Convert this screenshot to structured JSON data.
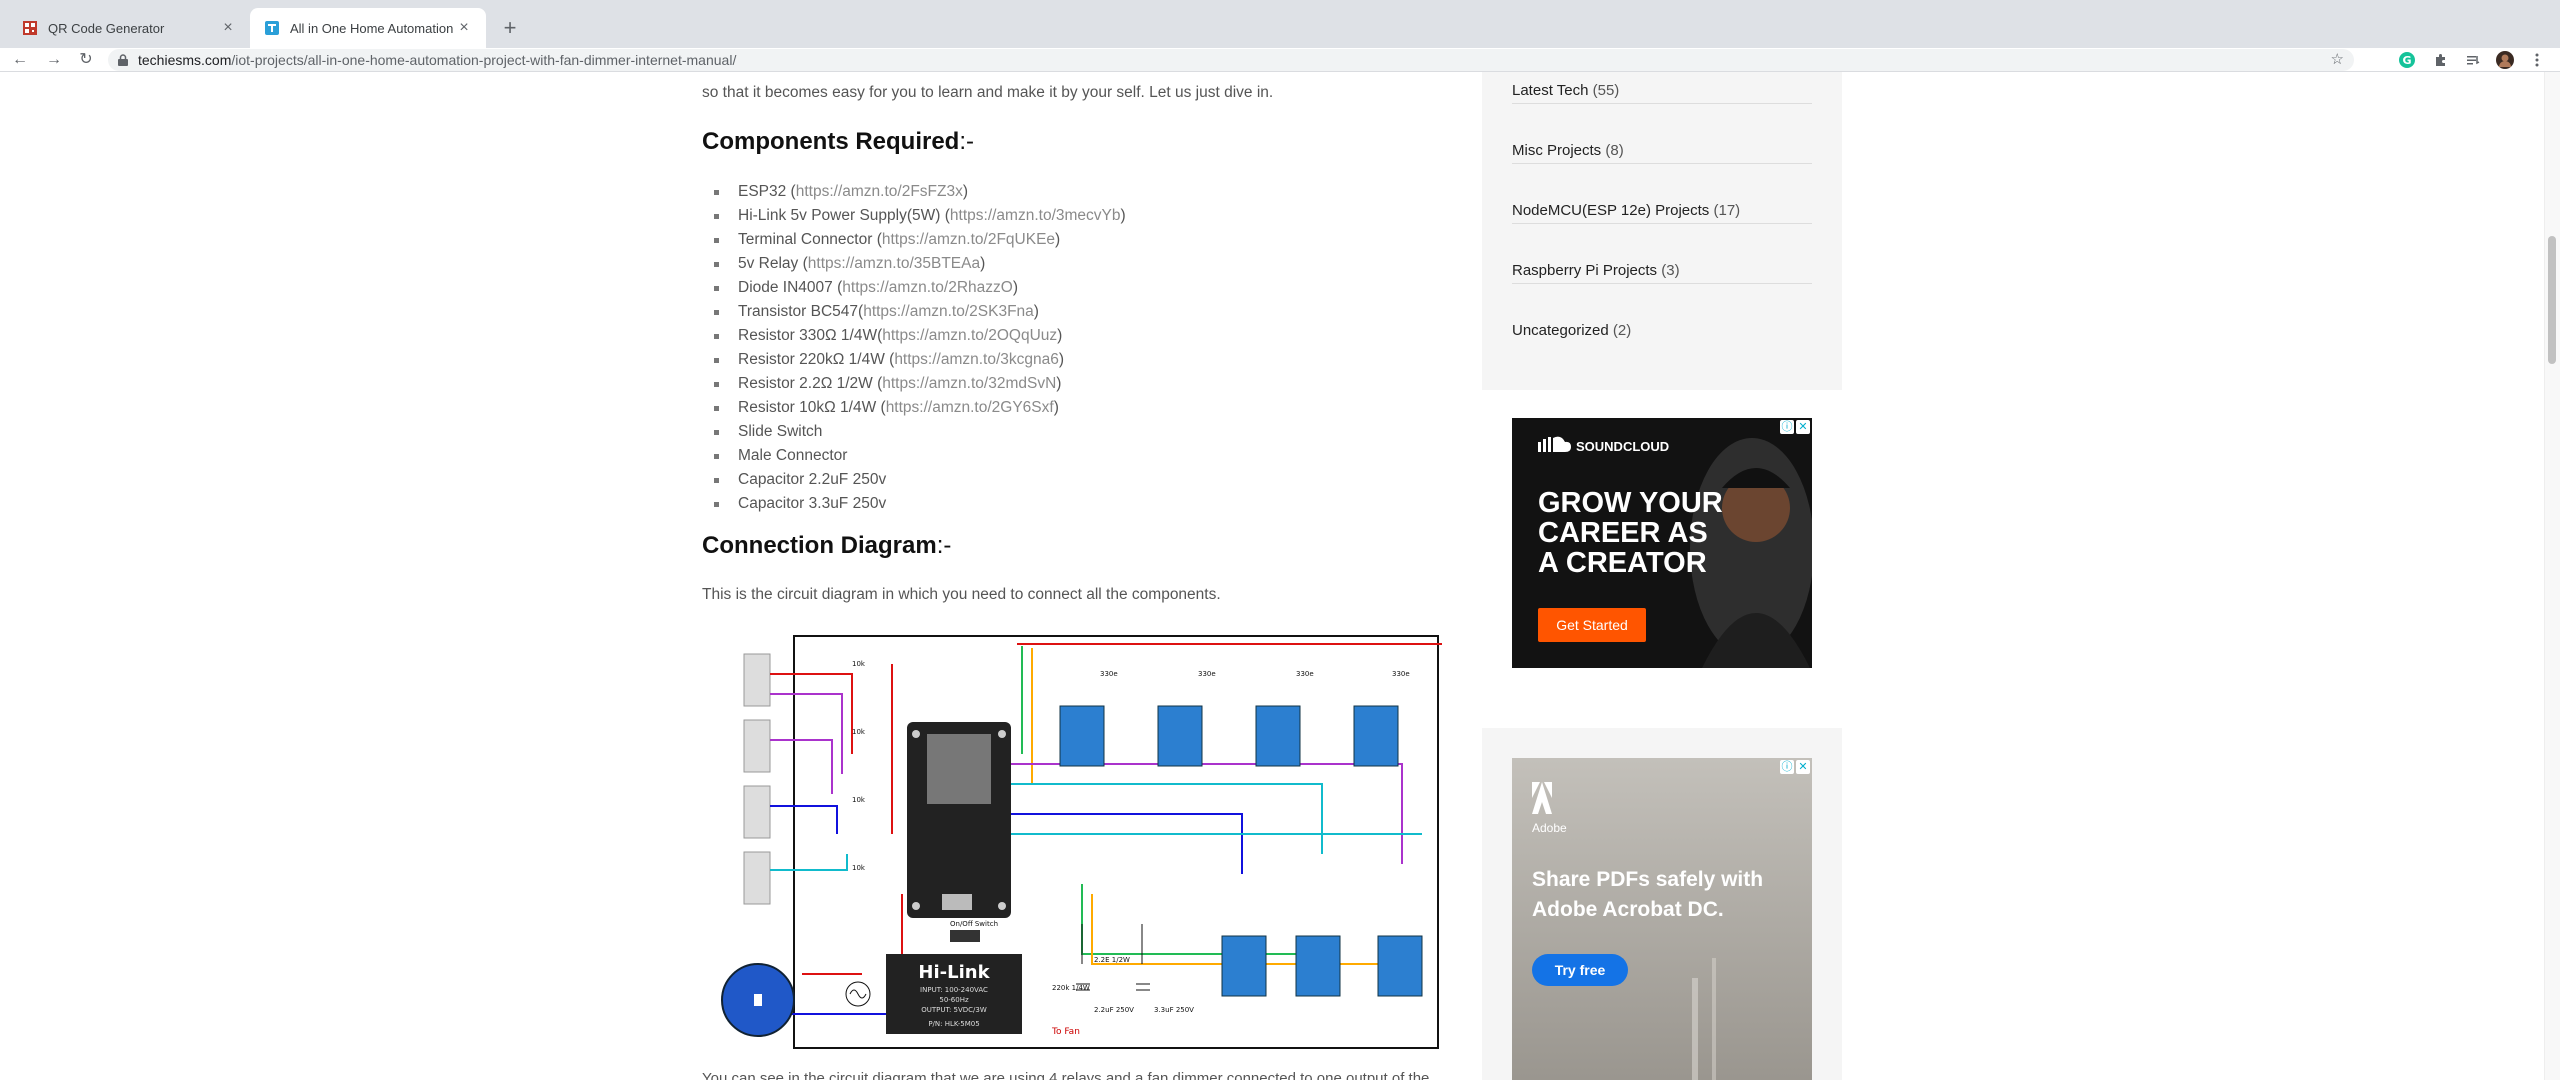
{
  "browser": {
    "tabs": [
      {
        "title": "QR Code Generator",
        "active": false
      },
      {
        "title": "All in One Home Automation p",
        "active": true
      }
    ],
    "url_host": "techiesms.com",
    "url_path": "/iot-projects/all-in-one-home-automation-project-with-fan-dimmer-internet-manual/"
  },
  "article": {
    "intro_tail": "so that it becomes easy for you to learn and make it by your self. Let us just dive in.",
    "components_heading": "Components Required",
    "heading_suffix": ":-",
    "components": [
      {
        "name": "ESP32 (",
        "link": "https://amzn.to/2FsFZ3x",
        "close": ")"
      },
      {
        "name": "Hi-Link 5v Power Supply(5W) (",
        "link": "https://amzn.to/3mecvYb",
        "close": ")"
      },
      {
        "name": "Terminal Connector (",
        "link": "https://amzn.to/2FqUKEe",
        "close": ")"
      },
      {
        "name": "5v Relay (",
        "link": "https://amzn.to/35BTEAa",
        "close": ")"
      },
      {
        "name": "Diode IN4007 (",
        "link": "https://amzn.to/2RhazzO",
        "close": ")"
      },
      {
        "name": "Transistor BC547(",
        "link": "https://amzn.to/2SK3Fna",
        "close": ")"
      },
      {
        "name": "Resistor 330Ω 1/4W(",
        "link": "https://amzn.to/2OQqUuz",
        "close": ")"
      },
      {
        "name": "Resistor 220kΩ 1/4W (",
        "link": "https://amzn.to/3kcgna6",
        "close": ")"
      },
      {
        "name": "Resistor 2.2Ω 1/2W (",
        "link": "https://amzn.to/32mdSvN",
        "close": ")"
      },
      {
        "name": "Resistor 10kΩ 1/4W (",
        "link": "https://amzn.to/2GY6Sxf",
        "close": ")"
      },
      {
        "name": "Slide Switch",
        "link": "",
        "close": ""
      },
      {
        "name": "Male Connector",
        "link": "",
        "close": ""
      },
      {
        "name": "Capacitor 2.2uF 250v",
        "link": "",
        "close": ""
      },
      {
        "name": "Capacitor 3.3uF 250v",
        "link": "",
        "close": ""
      }
    ],
    "connection_heading": "Connection Diagram",
    "connection_desc": "This is the circuit diagram in which you need to connect all the components.",
    "diagram_labels": {
      "hilink_brand": "Hi-Link",
      "hilink_input": "INPUT: 100-240VAC",
      "hilink_freq": "50-60Hz",
      "hilink_output": "OUTPUT: 5VDC/3W",
      "hilink_model": "P/N: HLK-5M05",
      "switch": "On/Off Switch",
      "to_fan": "To Fan",
      "res_330": "330e",
      "res_10k": "10k",
      "res_22": "2.2E 1/2W",
      "cap_22": "2.2uF 250V",
      "cap_33": "3.3uF 250V",
      "res_220k": "220k 1/4W"
    },
    "bottom_partial": "You can see in the circuit diagram that we are using 4 relays and a fan dimmer connected to one output of the circuit."
  },
  "sidebar": {
    "categories": [
      {
        "name": "Latest Tech",
        "count": "(55)"
      },
      {
        "name": "Misc Projects",
        "count": "(8)"
      },
      {
        "name": "NodeMCU(ESP 12e) Projects",
        "count": "(17)"
      },
      {
        "name": "Raspberry Pi Projects",
        "count": "(3)"
      },
      {
        "name": "Uncategorized",
        "count": "(2)"
      }
    ],
    "ad_soundcloud": {
      "brand": "SOUNDCLOUD",
      "line1": "GROW YOUR",
      "line2": "CAREER AS",
      "line3": "A CREATOR",
      "cta": "Get Started"
    },
    "ad_adobe": {
      "brand": "Adobe",
      "headline1": "Share PDFs safely with",
      "headline2": "Adobe Acrobat DC.",
      "cta": "Try free"
    }
  },
  "colors": {
    "accent_orange": "#ff5500",
    "adobe_blue": "#1473e6",
    "relay_blue": "#2c7fd0"
  }
}
